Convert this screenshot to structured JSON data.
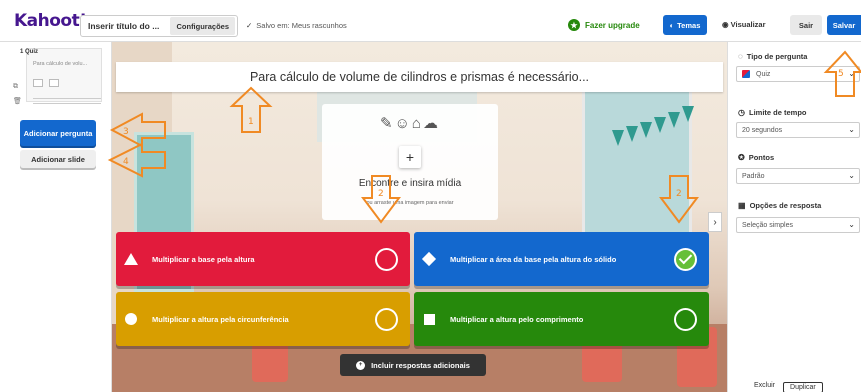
{
  "header": {
    "logo": "Kahoot!",
    "title_placeholder": "Inserir título do ...",
    "settings_label": "Configurações",
    "saved_text": "Salvo em: Meus rascunhos",
    "upgrade_label": "Fazer upgrade",
    "themes_label": "Temas",
    "preview_label": "Visualizar",
    "exit_label": "Sair",
    "save_label": "Salvar"
  },
  "sidebar": {
    "slide_number": "1  Quiz",
    "slide_subtitle": "Para cálculo de volu...",
    "add_question_label": "Adicionar pergunta",
    "add_slide_label": "Adicionar slide"
  },
  "canvas": {
    "question": "Para cálculo de volume de cilindros e prismas é necessário...",
    "media_title": "Encontre e insira mídia",
    "media_hint": "ou arraste uma imagem para enviar",
    "add_answers_label": "Incluir respostas adicionais",
    "answers": [
      {
        "text": "Multiplicar a base pela altura",
        "shape": "triangle",
        "color": "#e21b3c",
        "correct": false
      },
      {
        "text": "Multiplicar a área da base pela altura do sólido",
        "shape": "diamond",
        "color": "#1368ce",
        "correct": true
      },
      {
        "text": "Multiplicar a altura pela circunferência",
        "shape": "circle",
        "color": "#d89e00",
        "correct": false
      },
      {
        "text": "Multiplicar a altura pelo comprimento",
        "shape": "square",
        "color": "#26890c",
        "correct": false
      }
    ]
  },
  "panel": {
    "question_type_label": "Tipo de pergunta",
    "question_type_value": "Quiz",
    "time_limit_label": "Limite de tempo",
    "time_limit_value": "20 segundos",
    "points_label": "Pontos",
    "points_value": "Padrão",
    "answer_options_label": "Opções de resposta",
    "answer_options_value": "Seleção simples",
    "delete_label": "Excluir",
    "duplicate_label": "Duplicar"
  },
  "annotations": [
    "1",
    "2",
    "2",
    "2",
    "3",
    "4",
    "5"
  ],
  "colors": {
    "brand": "#46178f",
    "accent_blue": "#1368ce",
    "annotation_orange": "#f08a24"
  }
}
